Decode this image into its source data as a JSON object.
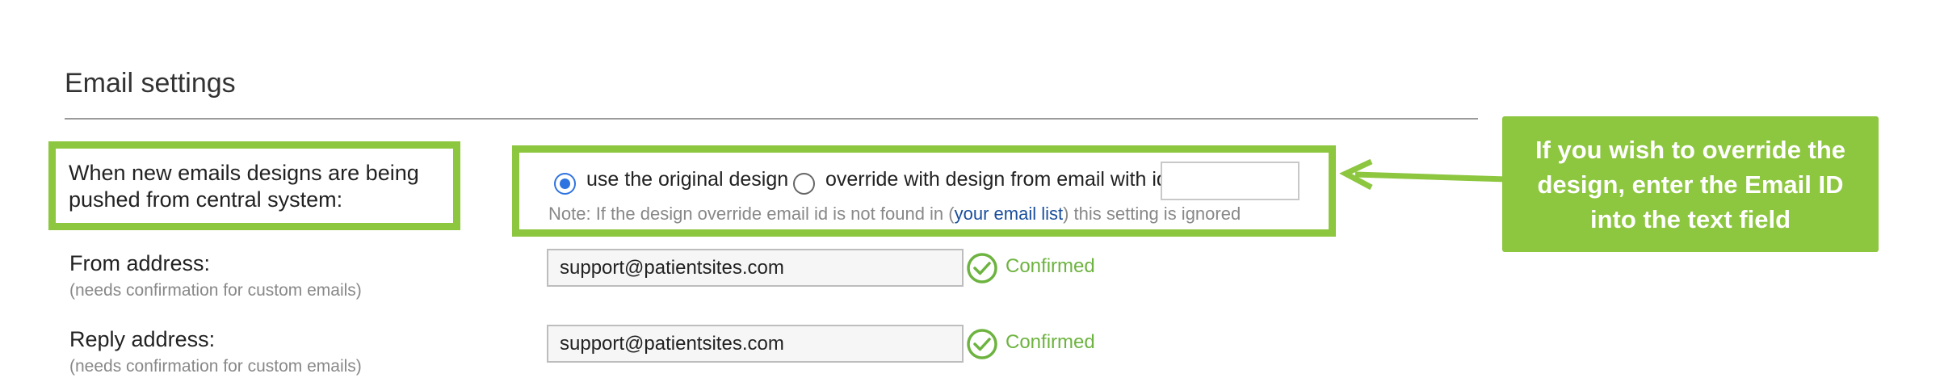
{
  "section": {
    "title": "Email settings"
  },
  "design": {
    "label": "When new emails designs are being pushed from central system:",
    "option_original": "use the original design",
    "option_override": "override with design from email with id",
    "override_id_value": "",
    "note_prefix": "Note: If the design override email id is not found in (",
    "note_link": "your email list",
    "note_suffix": ") this setting is ignored"
  },
  "from": {
    "label": "From address:",
    "sublabel": "(needs confirmation for custom emails)",
    "value": "support@patientsites.com",
    "status": "Confirmed"
  },
  "reply": {
    "label": "Reply address:",
    "sublabel": "(needs confirmation for custom emails)",
    "value": "support@patientsites.com",
    "status": "Confirmed"
  },
  "annotation": {
    "callout_text": "If you wish to override the design, enter the Email ID into the text field"
  },
  "colors": {
    "highlight": "#8dc63f",
    "confirmed": "#6db33f",
    "radio_selected": "#2f73e0",
    "link": "#1a4e9c"
  },
  "icons": {
    "confirmed": "check-circle-icon",
    "arrow": "arrow-left-icon"
  }
}
